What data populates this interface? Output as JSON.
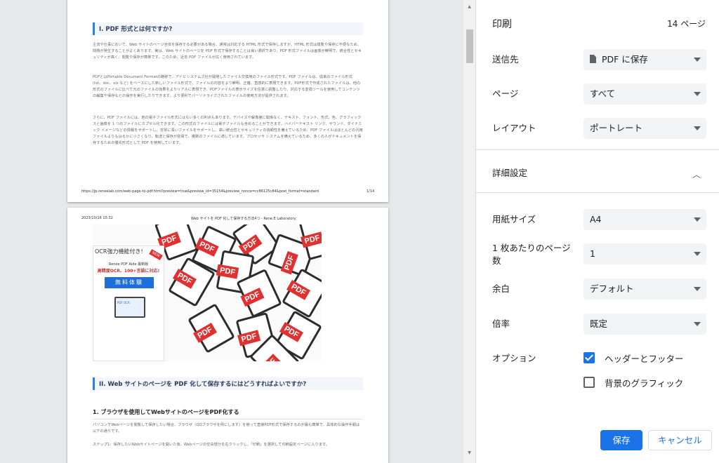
{
  "preview": {
    "page1": {
      "heading": "I. PDF 形式とは何ですか?",
      "paragraphs": [
        "主流や仕事において、Web サイトのページ全体を保存する必要がある場合、通常は対応する HTML 形式で保存しますが、HTML 形式は閲覧や保存に不便なため、問題が発生することがよくあります。実は、Web サイトのページを PDF 形式で保存することは良い選択であり、PDF 形式ファイルは画像が鮮明で、統合性とセキュリティが高く、閲覧や保存が簡単です。このため、近年 PDF ファイルが広く使用されています。",
        "PDFとはPortable Document Formatの略称で、アドビシステムズ社が開発したファイル交換用のファイル形式です。PDF ファイルは、従来のファイル形式 (txt、doc、xls など) をベースにした新しいファイル形式で、ファイルの内容をより鮮明、正確、直感的に表現できます。PDF形式で作成されたファイルは、他の形式のファイルに比べて元のファイルの効果をよりリアルに表現でき、PDFファイルの表示サイズを任意に調整したり、対応する変換ツールを使用してコンテンツの編集や保存などの操作を実行したりできます。より便利でパーソナライズされたファイルの使用方法が提供されます。",
        "さらに、PDF ファイルには、他の電子ファイル形式にはない多くの利点もあります。デバイスや解像度に関係なく、テキスト、フォント、形式、色、グラフィックスと画像を 1 つのファイルにカプセル化できます。この形式のファイルには電子ファイルも含めることができます。ハイパーテキスト リンク、サウンド、ダイナミック イメージなどの情報をサポートし、非常に長いファイルをサポートし、高い統合性とセキュリティの信頼性を備えているため、PDF ファイルはほとんどの汎用ファイルよりもはるかに小さくなり、転送と保存が容易で、複数のファイルに適しています。プロセッサ システムを備えているため、多くの人がドキュメントを保存するための優先形式として PDF を使用しています。"
      ],
      "footer_url": "https://jp.reneelab.com/web-page-to-pdf.html?preview=true&preview_id=35154&preview_nonce=cc86125c84&post_format=standard",
      "footer_page": "1/14"
    },
    "page2": {
      "header_date": "2023/10/16 15:32",
      "header_title": "Web サイトを PDF 化して保存する方法4つ - Rene.E Laboratory",
      "ad": {
        "ocr_title": "OCR強力機能付き!",
        "line1": "Renee PDF Aide 最新版",
        "line2": "高精度OCR、100+言語に対応!",
        "button": "無料体験",
        "badge": "NEW",
        "screen_label": "PDF OCR"
      },
      "pdf_label": "PDF",
      "heading": "II. Web サイトのページを PDF 化して保存するにはどうすればよいですか?",
      "subheading": "1. ブラウザを使用してWebサイトのページをPDF化する",
      "paragraphs": [
        "パソコンでWebページを閲覧して保存したい場合、ブラウザ（QQブラウザを例にします）を使って直接PDF形式で保存するのが最も簡単で、具体的な操作手順は以下の通りです。",
        "ステップ1：保存したいWebサイトページを開いた後、Webページの空白部分を右クリックし、「印刷」を選択して印刷設定ページに入ります。"
      ]
    }
  },
  "panel": {
    "title": "印刷",
    "page_count": "14 ページ",
    "destination": {
      "label": "送信先",
      "value": "PDF に保存"
    },
    "pages": {
      "label": "ページ",
      "value": "すべて"
    },
    "layout": {
      "label": "レイアウト",
      "value": "ポートレート"
    },
    "more_settings": "詳細設定",
    "paper_size": {
      "label": "用紙サイズ",
      "value": "A4"
    },
    "pages_per_sheet": {
      "label": "1 枚あたりのページ数",
      "value": "1"
    },
    "margins": {
      "label": "余白",
      "value": "デフォルト"
    },
    "scale": {
      "label": "倍率",
      "value": "既定"
    },
    "options": {
      "label": "オプション",
      "headers_footers": {
        "label": "ヘッダーとフッター",
        "checked": true
      },
      "background_graphics": {
        "label": "背景のグラフィック",
        "checked": false
      }
    },
    "save_button": "保存",
    "cancel_button": "キャンセル"
  },
  "colors": {
    "accent": "#1a73e8",
    "pdf_red": "#e03030",
    "heading_bar": "#3a7bd5"
  }
}
